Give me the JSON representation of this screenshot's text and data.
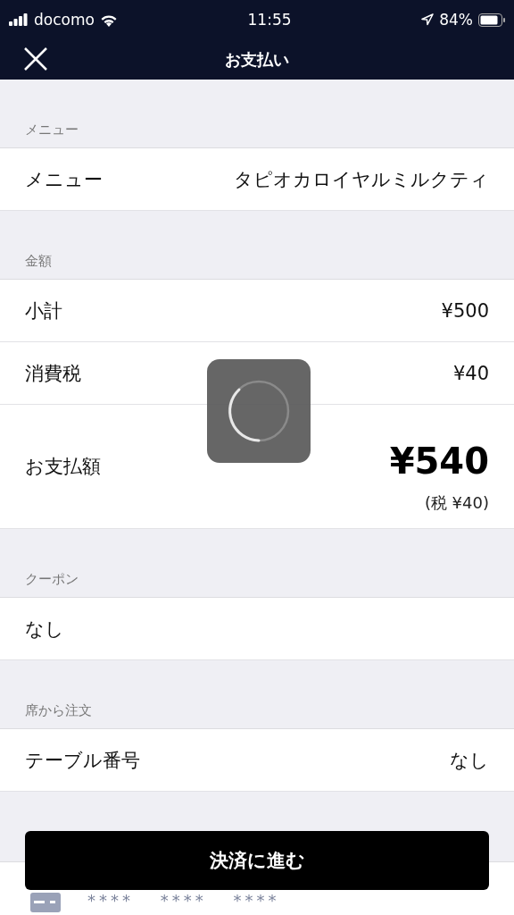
{
  "status_bar": {
    "carrier": "docomo",
    "time": "11:55",
    "battery": "84%"
  },
  "nav": {
    "title": "お支払い"
  },
  "sections": [
    {
      "header": "メニュー",
      "rows": [
        {
          "kind": "pair",
          "label": "メニュー",
          "value": "タピオカロイヤルミルクティ"
        }
      ]
    },
    {
      "header": "金額",
      "rows": [
        {
          "kind": "pair",
          "label": "小計",
          "value": "¥500"
        },
        {
          "kind": "pair",
          "label": "消費税",
          "value": "¥40"
        },
        {
          "kind": "total",
          "label": "お支払額",
          "value": "¥540",
          "note": "(税 ¥40)"
        }
      ]
    },
    {
      "header": "クーポン",
      "rows": [
        {
          "kind": "single",
          "label": "なし"
        }
      ]
    },
    {
      "header": "席から注文",
      "rows": [
        {
          "kind": "pair",
          "label": "テーブル番号",
          "value": "なし"
        }
      ]
    }
  ],
  "card": {
    "number": "**** **** ****"
  },
  "pay_button": {
    "label": "決済に進む"
  },
  "loading": true
}
